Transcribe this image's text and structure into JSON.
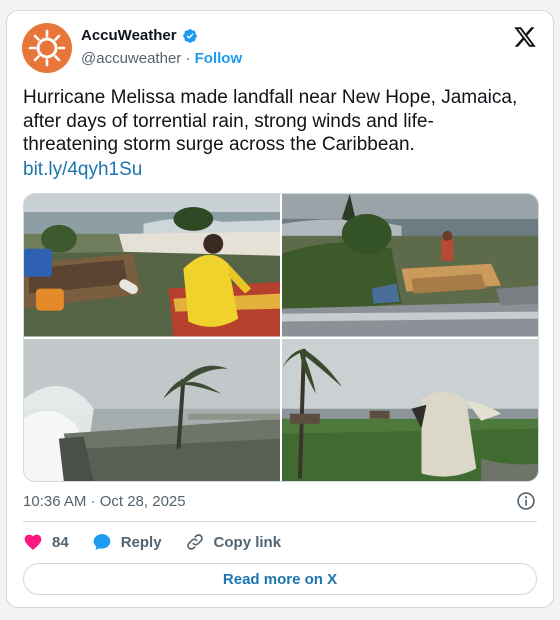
{
  "author": {
    "display_name": "AccuWeather",
    "handle": "@accuweather",
    "separator": "·",
    "follow_label": "Follow",
    "avatar_icon": "accuweather-sun-logo",
    "verified_icon": "verified-badge-icon",
    "verified_color": "#1d9bf0",
    "brand_color": "#e8763a"
  },
  "platform_icon": "x-logo-icon",
  "tweet": {
    "text": "Hurricane Melissa made landfall near New Hope, Jamaica, after days of torrential rain, strong winds and life-threatening storm surge across the Caribbean.",
    "link": "bit.ly/4qyh1Su"
  },
  "media": [
    {
      "name": "photo-man-yellow-raincoat-boats"
    },
    {
      "name": "photo-damaged-shoreline-debris"
    },
    {
      "name": "photo-waves-crashing-seawall"
    },
    {
      "name": "photo-person-in-poncho-palm-tree"
    }
  ],
  "timestamp": "10:36 AM · Oct 28, 2025",
  "actions": {
    "like_count": "84",
    "reply_label": "Reply",
    "copy_label": "Copy link",
    "like_color": "#f91880",
    "reply_color": "#1d9bf0"
  },
  "read_more_label": "Read more on X"
}
